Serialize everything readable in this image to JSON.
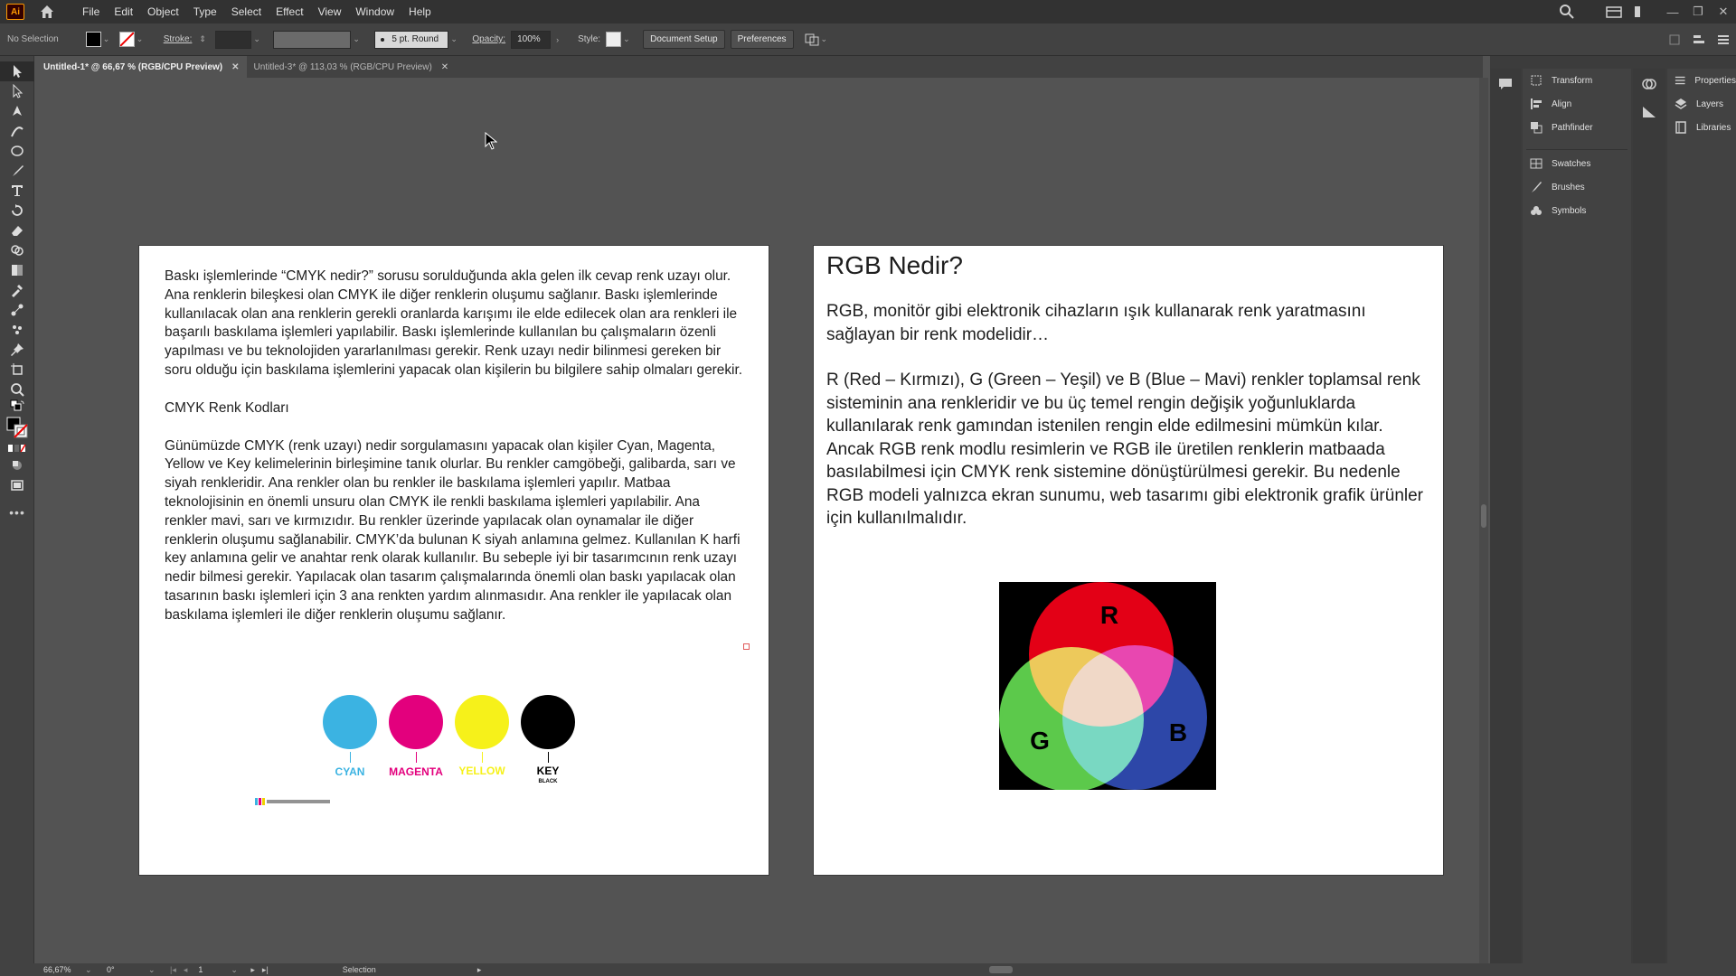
{
  "app": {
    "logo_text": "Ai",
    "menu": [
      "File",
      "Edit",
      "Object",
      "Type",
      "Select",
      "Effect",
      "View",
      "Window",
      "Help"
    ]
  },
  "control_bar": {
    "selection_state": "No Selection",
    "stroke_label": "Stroke:",
    "brush_value": "5 pt. Round",
    "opacity_label": "Opacity:",
    "opacity_value": "100%",
    "style_label": "Style:",
    "document_setup": "Document Setup",
    "preferences": "Preferences"
  },
  "tabs": [
    {
      "label": "Untitled-1* @ 66,67 % (RGB/CPU Preview)",
      "active": true
    },
    {
      "label": "Untitled-3* @ 113,03 % (RGB/CPU Preview)",
      "active": false
    }
  ],
  "panels": {
    "col1": [
      "Transform",
      "Align",
      "Pathfinder",
      "Swatches",
      "Brushes",
      "Symbols"
    ],
    "col2": [
      "Properties",
      "Layers",
      "Libraries"
    ]
  },
  "status": {
    "zoom": "66,67%",
    "rotation": "0°",
    "artboard_num": "1",
    "tool": "Selection"
  },
  "artboard1": {
    "para1": "Baskı işlemlerinde “CMYK nedir?” sorusu sorulduğunda akla gelen ilk cevap renk uzayı olur. Ana renklerin bileşkesi olan CMYK ile diğer renklerin oluşumu sağlanır. Baskı işlemlerinde kullanılacak olan ana renklerin gerekli oranlarda karışımı ile elde edilecek olan ara renkleri ile başarılı baskılama işlemleri yapılabilir. Baskı işlemlerinde kullanılan bu çalışmaların özenli yapılması ve bu teknolojiden yararlanılması gerekir. Renk uzayı nedir bilinmesi gereken bir soru olduğu için baskılama işlemlerini yapacak olan kişilerin bu bilgilere sahip olmaları gerekir.",
    "subheading": "CMYK Renk Kodları",
    "para2": "Günümüzde CMYK (renk uzayı) nedir sorgulamasını yapacak olan kişiler Cyan, Magenta, Yellow ve Key kelimelerinin birleşimine tanık olurlar. Bu renkler camgöbeği, galibarda, sarı ve siyah renkleridir. Ana renkler olan bu renkler ile baskılama işlemleri yapılır. Matbaa teknolojisinin en önemli unsuru olan CMYK ile renkli baskılama işlemleri yapılabilir. Ana renkler mavi, sarı ve kırmızıdır. Bu renkler üzerinde yapılacak olan oynamalar ile diğer renklerin oluşumu sağlanabilir. CMYK’da bulunan K siyah anlamına gelmez. Kullanılan K harfi key anlamına gelir ve anahtar renk olarak kullanılır. Bu sebeple iyi bir tasarımcının renk uzayı nedir bilmesi gerekir. Yapılacak olan tasarım çalışmalarında önemli olan baskı yapılacak olan tasarının baskı işlemleri için 3 ana renkten yardım alınmasıdır. Ana renkler ile yapılacak olan baskılama işlemleri ile diğer renklerin oluşumu sağlanır.",
    "cmyk": [
      {
        "label": "CYAN",
        "color": "#3bb3e2"
      },
      {
        "label": "MAGENTA",
        "color": "#e3007d"
      },
      {
        "label": "YELLOW",
        "color": "#f6f11a"
      },
      {
        "label": "KEY",
        "color": "#000000",
        "sub": "BLACK"
      }
    ]
  },
  "artboard2": {
    "title": "RGB Nedir?",
    "para1": "RGB, monitör gibi elektronik cihazların ışık kullanarak renk yaratmasını sağlayan bir renk modelidir…",
    "para2": "R (Red – Kırmızı), G (Green – Yeşil) ve B (Blue – Mavi) renkler toplamsal renk sisteminin ana renkleridir ve bu üç temel rengin değişik yoğunluklarda kullanılarak renk gamından istenilen rengin elde edilmesini mümkün kılar. Ancak RGB renk modlu resimlerin ve RGB ile üretilen renklerin matbaada basılabilmesi için CMYK renk sistemine dönüştürülmesi gerekir. Bu nedenle RGB modeli yalnızca ekran sunumu, web tasarımı gibi elektronik grafik ürünler için kullanılmalıdır.",
    "venn": {
      "r": "R",
      "g": "G",
      "b": "B"
    }
  }
}
